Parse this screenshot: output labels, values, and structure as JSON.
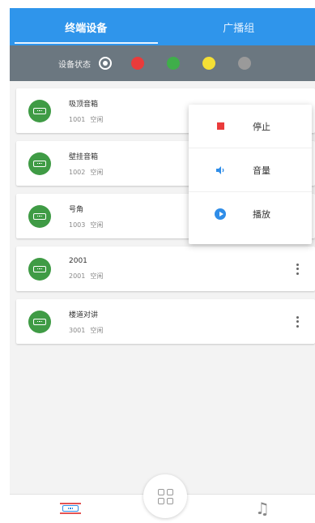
{
  "tabs": [
    {
      "label": "终端设备",
      "active": true
    },
    {
      "label": "广播组",
      "active": false
    }
  ],
  "status_bar": {
    "label": "设备状态",
    "filters": [
      {
        "name": "all",
        "color": "#ffffff"
      },
      {
        "name": "red",
        "color": "#e93b3b"
      },
      {
        "name": "green",
        "color": "#3fae4a"
      },
      {
        "name": "yellow",
        "color": "#f4df35"
      },
      {
        "name": "gray",
        "color": "#9a9a9a"
      }
    ]
  },
  "devices": [
    {
      "name": "吸顶音箱",
      "id": "1001",
      "status": "空闲",
      "icon": "speaker-icon"
    },
    {
      "name": "壁挂音箱",
      "id": "1002",
      "status": "空闲",
      "icon": "speaker-icon"
    },
    {
      "name": "号角",
      "id": "1003",
      "status": "空闲",
      "icon": "speaker-icon"
    },
    {
      "name": "2001",
      "id": "2001",
      "status": "空闲",
      "icon": "speaker-icon"
    },
    {
      "name": "楼道对讲",
      "id": "3001",
      "status": "空闲",
      "icon": "speaker-icon"
    }
  ],
  "popup_menu": [
    {
      "label": "停止",
      "icon": "stop-icon",
      "color": "#ea3b3b"
    },
    {
      "label": "音量",
      "icon": "volume-icon",
      "color": "#2f8de8"
    },
    {
      "label": "播放",
      "icon": "play-icon",
      "color": "#2f8de8"
    }
  ],
  "bottom_nav": {
    "left_icon": "device-icon",
    "center_icon": "grid-icon",
    "right_icon": "music-icon"
  },
  "colors": {
    "tab_bar": "#2f95eb",
    "status_bar": "#6b7780",
    "device_icon": "#3f9b45"
  }
}
